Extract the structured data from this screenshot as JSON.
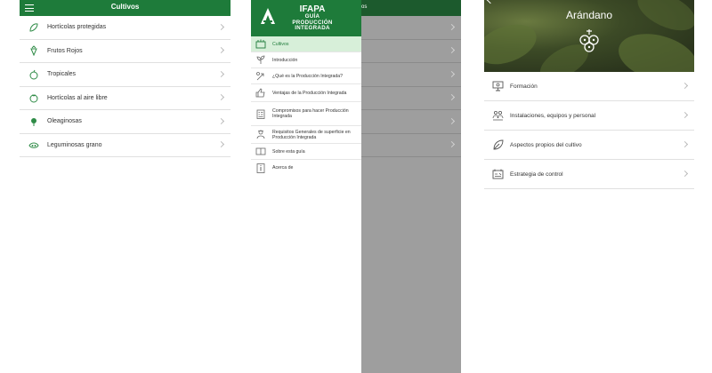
{
  "screen1": {
    "title": "Cultivos",
    "items": [
      {
        "label": "Hortícolas protegidas",
        "icon": "cucumber-icon"
      },
      {
        "label": "Frutos Rojos",
        "icon": "strawberry-icon"
      },
      {
        "label": "Tropicales",
        "icon": "avocado-icon"
      },
      {
        "label": "Hortícolas al aire libre",
        "icon": "tomato-icon"
      },
      {
        "label": "Oleaginosas",
        "icon": "sunflower-icon"
      },
      {
        "label": "Leguminosas grano",
        "icon": "beans-icon"
      }
    ]
  },
  "screen2": {
    "header_partial": "os",
    "brand": "IFAPA",
    "subtitle_lines": [
      "GUÍA",
      "PRODUCCIÓN",
      "INTEGRADA"
    ],
    "menu": [
      {
        "label": "Cultivos",
        "icon": "crops-icon",
        "active": true
      },
      {
        "label": "Introducción",
        "icon": "plant-icon",
        "active": false
      },
      {
        "label": "¿Qué es la Producción Integrada?",
        "icon": "question-plant-icon",
        "active": false
      },
      {
        "label": "Ventajas de la Producción Integrada",
        "icon": "thumbs-up-icon",
        "active": false
      },
      {
        "label": "Compromisos para hacer Producción Integrada",
        "icon": "checklist-icon",
        "active": false
      },
      {
        "label": "Requisitos Generales de superficie en Producción Integrada",
        "icon": "farmer-icon",
        "active": false
      },
      {
        "label": "Sobre esta guía",
        "icon": "book-icon",
        "active": false
      },
      {
        "label": "Acerca de",
        "icon": "info-icon",
        "active": false
      }
    ]
  },
  "screen3": {
    "title": "Arándano",
    "items": [
      {
        "label": "Formación",
        "icon": "training-icon"
      },
      {
        "label": "Instalaciones, equipos y personal",
        "icon": "team-icon"
      },
      {
        "label": "Aspectos propios del cultivo",
        "icon": "leaf-icon"
      },
      {
        "label": "Estrategia de control",
        "icon": "control-icon"
      }
    ]
  },
  "colors": {
    "brand_green": "#1e7b3a",
    "dark_green": "#1c5a2d",
    "active_bg": "#d7efd9"
  }
}
